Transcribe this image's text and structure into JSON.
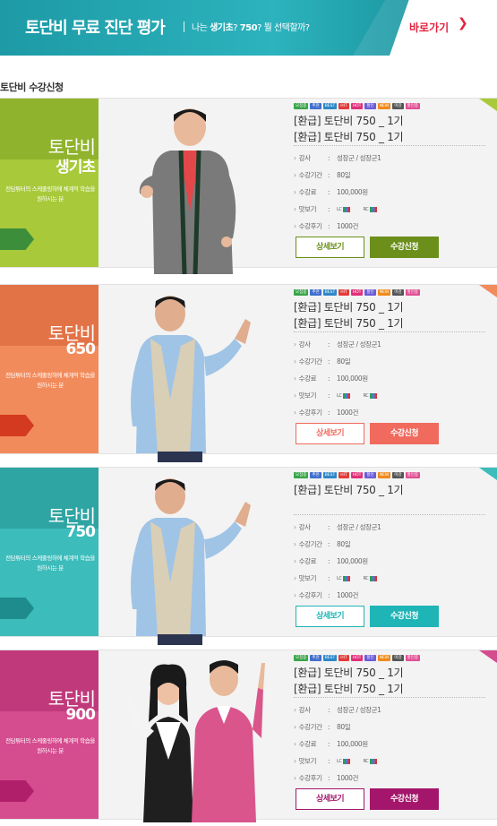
{
  "banner": {
    "title": "토단비 무료 진단 평가",
    "sub_prefix": "나는 ",
    "sub_bold1": "생기초",
    "sub_mid": "? ",
    "sub_bold2": "750",
    "sub_suffix": "? 뭘 선택할까?",
    "go_label": "바로가기",
    "go_arrow": "❯"
  },
  "section_title": "토단비 수강신청",
  "badges": [
    {
      "label": "모집중",
      "color": "#3aa54a"
    },
    {
      "label": "추천",
      "color": "#3f6fd0"
    },
    {
      "label": "BEST",
      "color": "#2e88c9"
    },
    {
      "label": "HIT",
      "color": "#e43a3a"
    },
    {
      "label": "HOT",
      "color": "#e0307a"
    },
    {
      "label": "할인",
      "color": "#6b5bd6"
    },
    {
      "label": "NEW",
      "color": "#f08a1c"
    },
    {
      "label": "마감",
      "color": "#555555"
    },
    {
      "label": "할인중",
      "color": "#e04f94"
    }
  ],
  "labels": {
    "teacher": "강사",
    "period": "수강기간",
    "fee": "수강료",
    "preview": "맛보기",
    "reviews": "수강후기",
    "lc": "LC",
    "rc": "RC",
    "colon": ":"
  },
  "courses": [
    {
      "name": "토단비",
      "level": "생기초",
      "desc": "전담튜터의 스케줄링하에 체계적 학습을 원하시는 분",
      "lines": [
        "[환급] 토단비 750 _ 1기",
        "[환급] 토단비 750 _ 1기"
      ],
      "teacher": "성장군 / 성장군1",
      "period": "80일",
      "fee": "100,000원",
      "reviews": "1000건",
      "detail_label": "상세보기",
      "apply_label": "수강신청",
      "colors": {
        "main": "#a8c93a",
        "dark": "#8fb32d",
        "accent": "#3c8e3a",
        "btn": "#6b8f1a"
      }
    },
    {
      "name": "토단비",
      "level": "650",
      "desc": "전담튜터의 스케줄링하에 체계적 학습을 원하시는 분",
      "lines": [
        "[환급] 토단비 750 _ 1기",
        "[환급] 토단비 750 _ 1기"
      ],
      "teacher": "성장군 / 성장군1",
      "period": "80일",
      "fee": "100,000원",
      "reviews": "1000건",
      "detail_label": "상세보기",
      "apply_label": "수강신청",
      "colors": {
        "main": "#f28b5c",
        "dark": "#e27347",
        "accent": "#d33a1f",
        "btn": "#f06a5e"
      }
    },
    {
      "name": "토단비",
      "level": "750",
      "desc": "전담튜터의 스케줄링하에 체계적 학습을 원하시는 분",
      "lines": [
        "[환급] 토단비 750 _ 1기"
      ],
      "teacher": "성장군 / 성장군1",
      "period": "80일",
      "fee": "100,000원",
      "reviews": "1000건",
      "detail_label": "상세보기",
      "apply_label": "수강신청",
      "colors": {
        "main": "#3cbcbb",
        "dark": "#2ea4a3",
        "accent": "#1e8b8d",
        "btn": "#1fb4b6"
      }
    },
    {
      "name": "토단비",
      "level": "900",
      "desc": "전담튜터의 스케줄링하에 체계적 학습을 원하시는 분",
      "lines": [
        "[환급] 토단비 750 _ 1기",
        "[환급] 토단비 750 _ 1기"
      ],
      "teacher": "성장군 / 성장군1",
      "period": "80일",
      "fee": "100,000원",
      "reviews": "1000건",
      "detail_label": "상세보기",
      "apply_label": "수강신청",
      "colors": {
        "main": "#d54c8f",
        "dark": "#c03a7b",
        "accent": "#b0206a",
        "btn": "#a3166b"
      }
    }
  ]
}
